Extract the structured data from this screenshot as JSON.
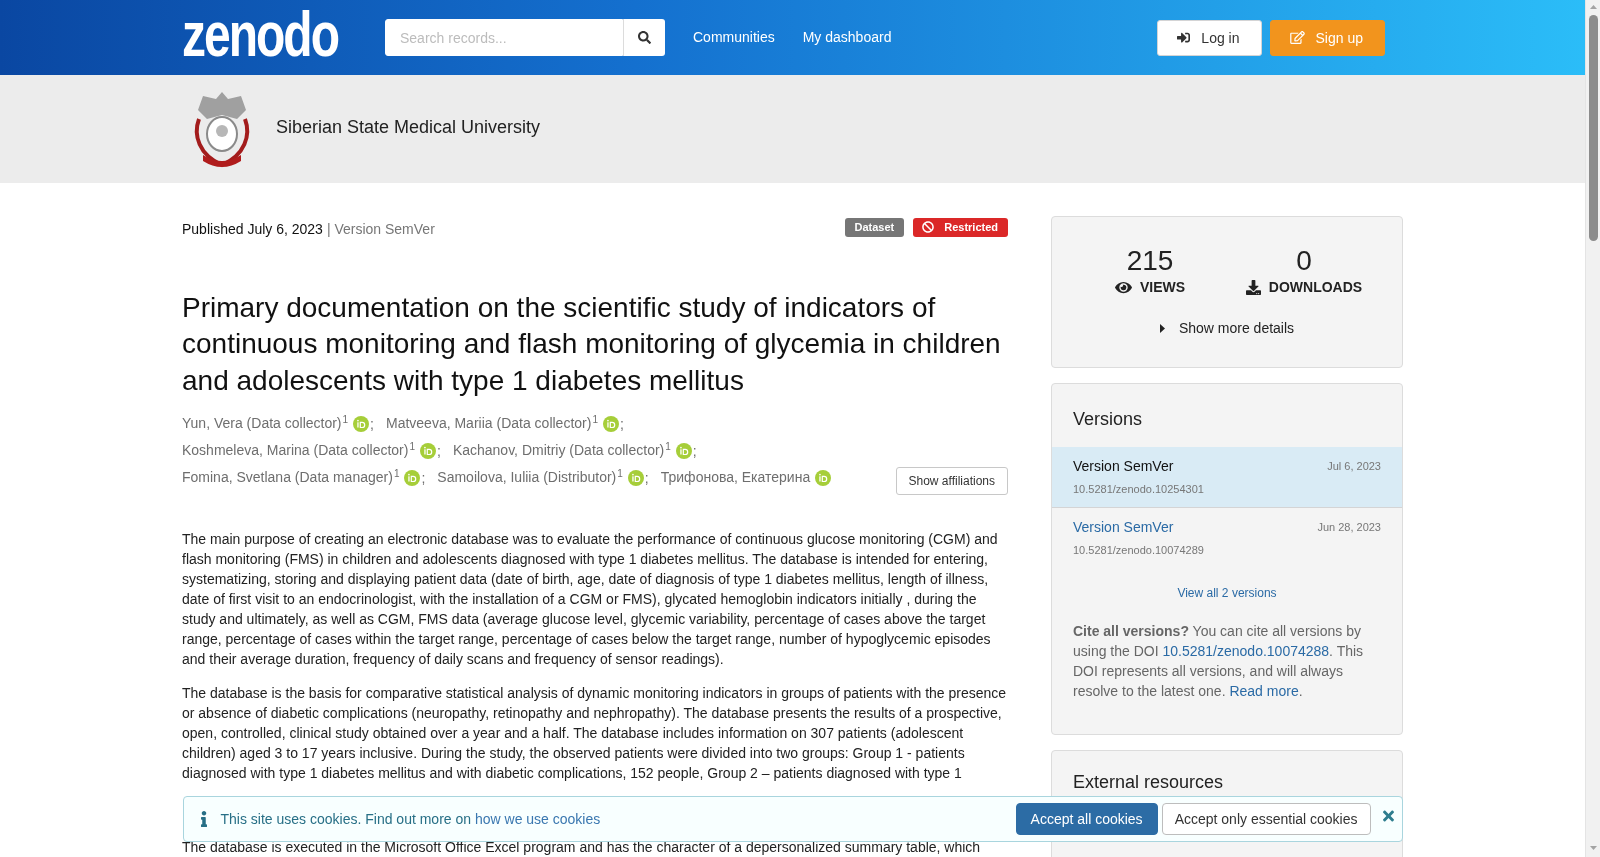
{
  "header": {
    "logo": "zenodo",
    "search": {
      "placeholder": "Search records..."
    },
    "nav": [
      "Communities",
      "My dashboard"
    ],
    "buttons": [
      {
        "label": "Log in",
        "kind": "login"
      },
      {
        "label": "Sign up",
        "kind": "signup"
      }
    ]
  },
  "community": {
    "name": "Siberian State Medical University"
  },
  "record": {
    "published": "Published July 6, 2023",
    "version": "| Version SemVer",
    "badges": [
      {
        "label": "Dataset",
        "kind": "resource_type"
      },
      {
        "label": "Restricted",
        "kind": "access"
      }
    ],
    "title": "Primary documentation on the scientific study of indicators of continuous monitoring and flash monitoring of glycemia in children and adolescents with type 1 diabetes mellitus",
    "creators": [
      {
        "name": "Yun, Vera (Data collector)$^{1}$",
        "orcid": true,
        "separator": ";"
      },
      {
        "name": "Matveeva, Mariia (Data collector)$^{1}$",
        "orcid": true,
        "separator": ";"
      },
      {
        "name": "Koshmeleva, Marina (Data collector)$^{1}$",
        "orcid": true,
        "separator": ";"
      },
      {
        "name": "Kachanov, Dmitriy (Data collector)$^{1}$",
        "orcid": true,
        "separator": ";"
      },
      {
        "name": "Fomina, Svetlana (Data manager)$^{1}$",
        "orcid": true,
        "separator": ";"
      },
      {
        "name": "Samoilova, Iuliia (Distributor)$^{1}$",
        "orcid": true,
        "separator": ";"
      },
      {
        "name": "Трифонова, Екатерина",
        "orcid": true
      }
    ],
    "show_affiliations": "Show affiliations",
    "description": [
      "The main purpose of creating an electronic database was to evaluate the performance of continuous glucose monitoring (CGM) and flash monitoring (FMS) in children and adolescents diagnosed with type 1 diabetes mellitus. The database is intended for entering, systematizing, storing and displaying patient data (date of birth, age, date of diagnosis of type 1 diabetes mellitus, length of illness, date of first visit to an endocrinologist, with the installation of a CGM or FMS), glycated hemoglobin indicators initially , during the study and ultimately, as well as CGM, FMS data (average glucose level, glycemic variability, percentage of cases above the target range, percentage of cases within the target range, percentage of cases below the target range, number of hypoglycemic episodes and their average duration, frequency of daily scans and frequency of sensor readings).",
      "The database is the basis for comparative statistical analysis of dynamic monitoring indicators in groups of patients with the presence or absence of diabetic complications (neuropathy, retinopathy and nephropathy). The database presents the results of a prospective, open, controlled, clinical study obtained over a year and a half. The database includes information on 307 patients (adolescent children) aged 3 to 17 years inclusive. During the study, the observed patients were divided into two groups: Group 1 - patients diagnosed with type 1 diabetes mellitus and with diabetic complications, 152 people, Group 2 – patients diagnosed with type 1",
      "The database is executed in the Microsoft Office Excel program and has the character of a depersonalized summary table, which"
    ]
  },
  "sidebar": {
    "stats": [
      {
        "value": "215",
        "label": "VIEWS",
        "kind": "views"
      },
      {
        "value": "0",
        "label": "DOWNLOADS",
        "kind": "downloads"
      }
    ],
    "details_toggle": {
      "label": "Show more details",
      "expanded": false
    },
    "versions": {
      "title": "Versions",
      "items": [
        {
          "label": "Version SemVer",
          "date": "Jul 6, 2023",
          "doi": "10.5281/zenodo.10254301",
          "selected": true
        },
        {
          "label": "Version SemVer",
          "date": "Jun 28, 2023",
          "doi": "10.5281/zenodo.10074289",
          "selected": false
        }
      ],
      "view_all": "View all 2 versions",
      "cite_note": [
        {
          "text": "Cite all versions?",
          "kind": "strong"
        },
        {
          "text": " You can cite all versions by using the DOI ",
          "kind": "plain"
        },
        {
          "text": "10.5281/zenodo.10074288",
          "kind": "link"
        },
        {
          "text": ". This DOI represents all versions, and will always resolve to the latest one. ",
          "kind": "plain"
        },
        {
          "text": "Read more",
          "kind": "link"
        },
        {
          "text": ".",
          "kind": "plain"
        }
      ]
    },
    "external_resources": {
      "title": "External resources"
    }
  },
  "cookie_banner": {
    "message": [
      {
        "text": "This site uses cookies. Find out more on ",
        "kind": "plain"
      },
      {
        "text": "how we use cookies",
        "kind": "link"
      }
    ],
    "buttons": [
      {
        "label": "Accept all cookies",
        "kind": "primary"
      },
      {
        "label": "Accept only essential cookies",
        "kind": "secondary"
      }
    ]
  }
}
